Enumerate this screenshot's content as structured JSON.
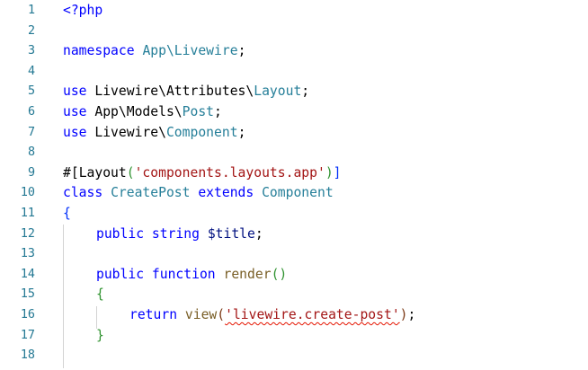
{
  "editor": {
    "line_numbers": [
      "1",
      "2",
      "3",
      "4",
      "5",
      "6",
      "7",
      "8",
      "9",
      "10",
      "11",
      "12",
      "13",
      "14",
      "15",
      "16",
      "17",
      "18"
    ],
    "lines": {
      "l1": {
        "t1": "<?php"
      },
      "l3": {
        "t1": "namespace",
        "t2": " ",
        "t3": "App\\Livewire",
        "t4": ";"
      },
      "l5": {
        "t1": "use",
        "t2": " Livewire\\Attributes\\",
        "t3": "Layout",
        "t4": ";"
      },
      "l6": {
        "t1": "use",
        "t2": " App\\Models\\",
        "t3": "Post",
        "t4": ";"
      },
      "l7": {
        "t1": "use",
        "t2": " Livewire\\",
        "t3": "Component",
        "t4": ";"
      },
      "l9": {
        "t1": "#[",
        "t2": "Layout",
        "t3": "(",
        "t4": "'components.layouts.app'",
        "t5": ")",
        "t6": "]"
      },
      "l10": {
        "t1": "class",
        "t2": " ",
        "t3": "CreatePost",
        "t4": " ",
        "t5": "extends",
        "t6": " ",
        "t7": "Component"
      },
      "l11": {
        "t1": "{"
      },
      "l12": {
        "t1": "public",
        "t2": " ",
        "t3": "string",
        "t4": " ",
        "t5": "$title",
        "t6": ";"
      },
      "l14": {
        "t1": "public",
        "t2": " ",
        "t3": "function",
        "t4": " ",
        "t5": "render",
        "t6": "()"
      },
      "l15": {
        "t1": "{"
      },
      "l16": {
        "t1": "return",
        "t2": " ",
        "t3": "view",
        "t4": "(",
        "t5": "'livewire.create-post'",
        "t6": ")",
        "t7": ";"
      },
      "l17": {
        "t1": "}"
      }
    }
  },
  "colors": {
    "line_number": "#237893",
    "keyword": "#0000ff",
    "type": "#267f99",
    "string": "#a31515",
    "variable": "#001080",
    "function": "#795e26",
    "error_squiggle": "#e51400",
    "indent_guide": "#d3d3d3"
  }
}
